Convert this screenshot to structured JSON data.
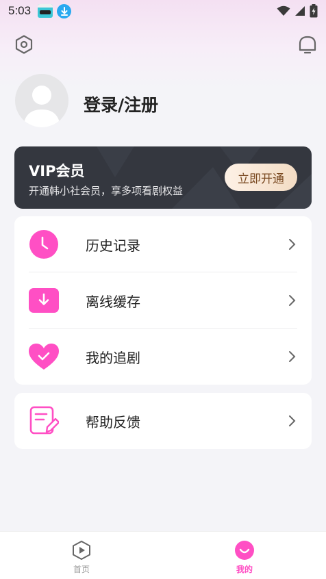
{
  "status_bar": {
    "time": "5:03"
  },
  "header": {
    "settings_icon": "hexagon-settings-icon",
    "message_icon": "message-bubble-icon"
  },
  "profile": {
    "login_label": "登录/注册"
  },
  "vip": {
    "title": "VIP会员",
    "subtitle": "开通韩小社会员，享多项看剧权益",
    "button_label": "立即开通"
  },
  "menu": {
    "items": [
      {
        "label": "历史记录",
        "icon": "clock-icon"
      },
      {
        "label": "离线缓存",
        "icon": "download-icon"
      },
      {
        "label": "我的追剧",
        "icon": "heart-check-icon"
      }
    ],
    "help": {
      "label": "帮助反馈",
      "icon": "feedback-note-icon"
    }
  },
  "bottom_nav": {
    "items": [
      {
        "label": "首页",
        "icon": "home-play-icon",
        "active": false
      },
      {
        "label": "我的",
        "icon": "profile-smile-icon",
        "active": true
      }
    ]
  },
  "colors": {
    "accent": "#ff4fc4",
    "vip_card": "#34373f",
    "vip_button_text": "#7a4a22"
  }
}
